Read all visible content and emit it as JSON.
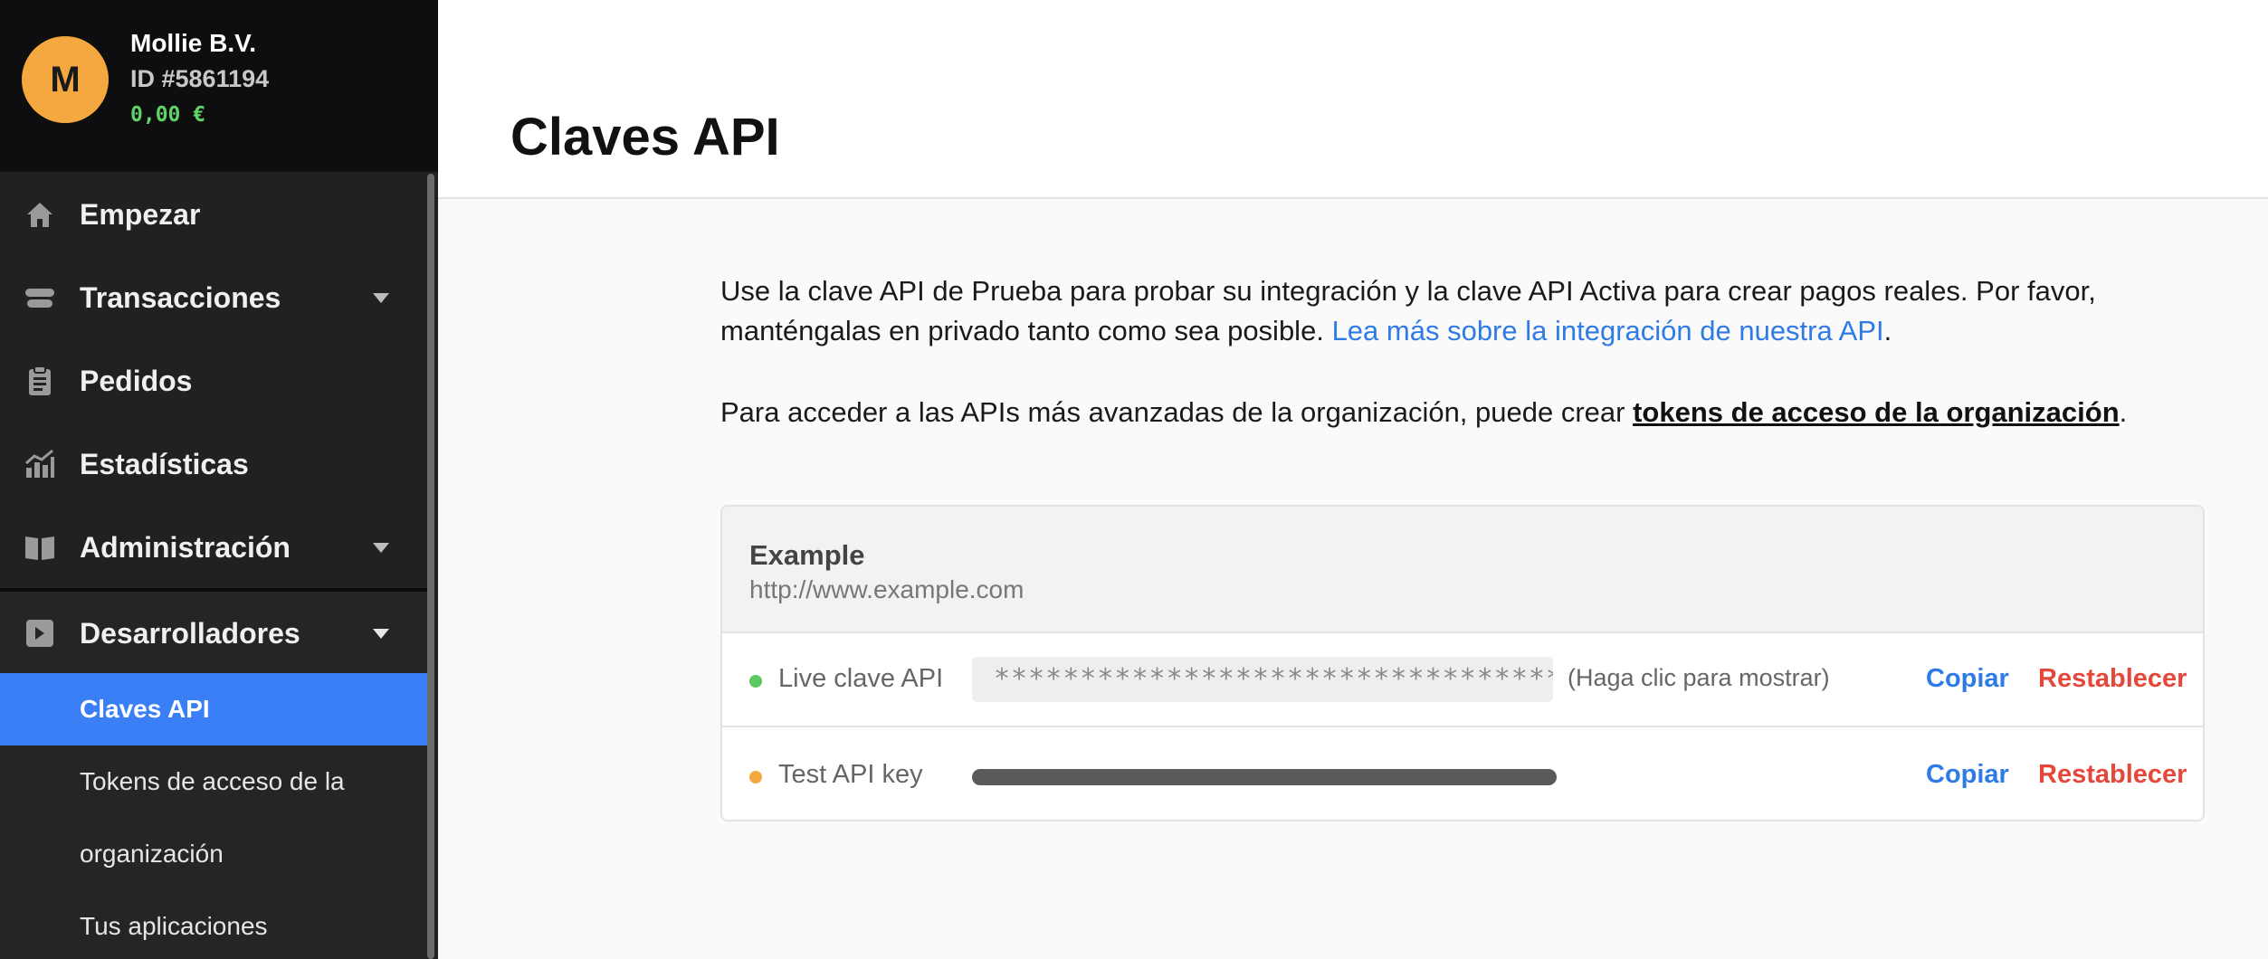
{
  "account": {
    "avatar_letter": "M",
    "name": "Mollie B.V.",
    "id": "ID #5861194",
    "balance": "0,00 €"
  },
  "nav": {
    "start": "Empezar",
    "transactions": "Transacciones",
    "orders": "Pedidos",
    "statistics": "Estadísticas",
    "administration": "Administración",
    "developers": "Desarrolladores"
  },
  "dev_menu": {
    "api_keys": "Claves API",
    "org_tokens_line1": "Tokens de acceso de la",
    "org_tokens_line2": "organización",
    "your_apps": "Tus aplicaciones"
  },
  "page": {
    "title": "Claves API",
    "intro_text": "Use la clave API de Prueba para probar su integración y la clave API Activa para crear pagos reales. Por favor, manténgalas en privado tanto como sea posible.",
    "intro_link": "Lea más sobre la integración de nuestra API",
    "intro_end": ".",
    "org_text": "Para acceder a las APIs más avanzadas de la organización, puede crear",
    "org_link": "tokens de acceso de la organización",
    "org_end": "."
  },
  "profile": {
    "name": "Example",
    "url": "http://www.example.com",
    "live": {
      "label": "Live clave API",
      "masked_value": "***********************************",
      "hint": "(Haga clic para mostrar)",
      "copy_label": "Copiar",
      "reset_label": "Restablecer",
      "status_color": "#5cc85f"
    },
    "test": {
      "label": "Test API key",
      "copy_label": "Copiar",
      "reset_label": "Restablecer",
      "status_color": "#f5a83f"
    }
  },
  "colors": {
    "accent": "#3a7ff6",
    "link": "#2f7be6",
    "danger": "#e5483b",
    "balance": "#5fd36a"
  }
}
